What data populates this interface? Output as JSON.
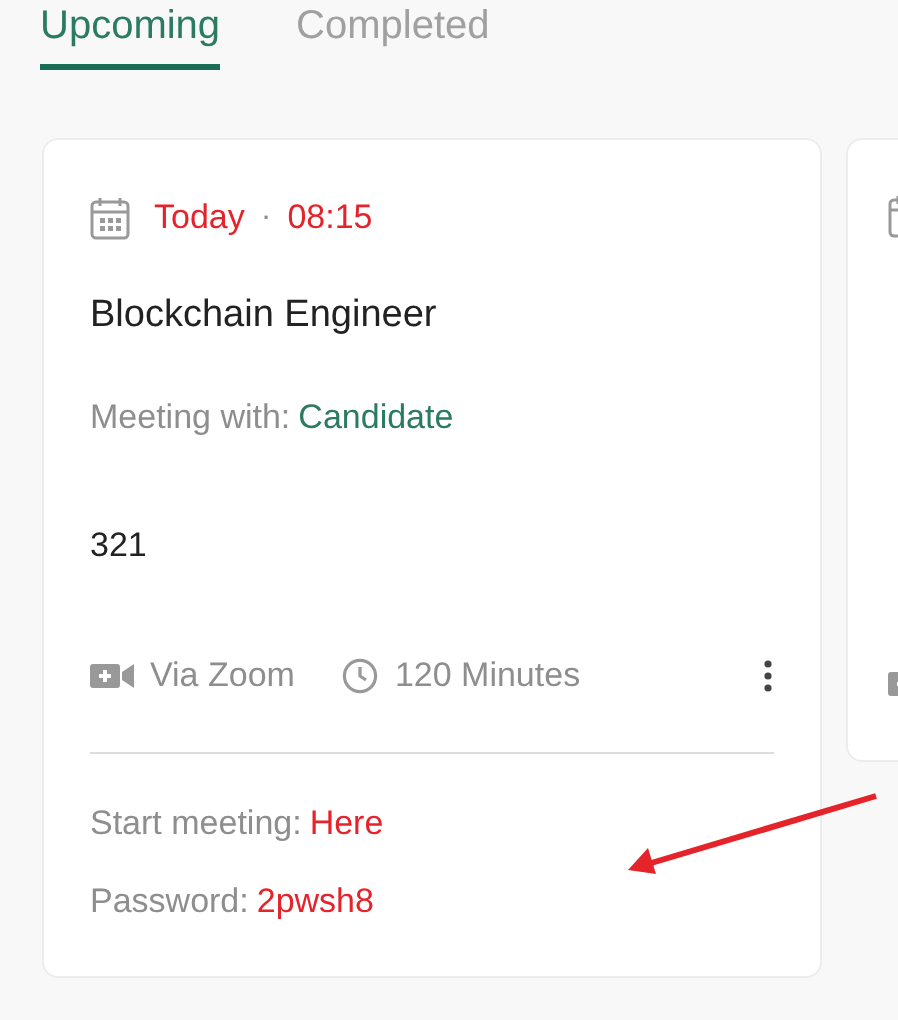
{
  "tabs": [
    {
      "label": "Upcoming",
      "selected": true
    },
    {
      "label": "Completed",
      "selected": false
    }
  ],
  "meetings": [
    {
      "date": "Today",
      "separator": "·",
      "time": "08:15",
      "title": "Blockchain Engineer",
      "meeting_with_label": "Meeting with:",
      "meeting_with": "Candidate",
      "description": "321",
      "platform": "Via Zoom",
      "duration": "120 Minutes",
      "start_label": "Start meeting:",
      "start_link": "Here",
      "password_label": "Password:",
      "password": "2pwsh8"
    },
    {
      "kind": "partial"
    }
  ]
}
